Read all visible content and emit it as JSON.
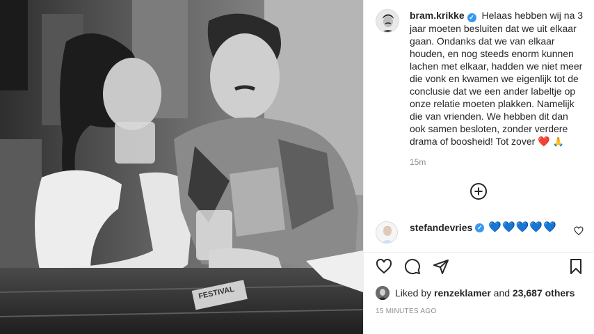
{
  "post": {
    "author": "bram.krikke",
    "caption": "Helaas hebben wij na 3 jaar moeten besluiten dat we uit elkaar gaan. Ondanks dat we van elkaar houden, en nog steeds enorm kunnen lachen met elkaar, hadden we niet meer die vonk en kwamen we eigenlijk tot de conclusie dat we een ander labeltje op onze relatie moeten plakken. Namelijk die van vrienden. We hebben dit dan ook samen besloten, zonder verdere drama of boosheid! Tot zover",
    "caption_emoji_heart": "❤️",
    "caption_emoji_pray": "🙏",
    "time": "15m",
    "photo_sign_text": "FESTIVAL",
    "photo_subject": "black-and-white photo of a couple at a wooden table with drinks"
  },
  "comment": {
    "user": "stefandevries",
    "text": "💙💙💙💙💙"
  },
  "actions": {
    "like": "heart-icon",
    "comment": "comment-icon",
    "share": "share-icon",
    "save": "bookmark-icon"
  },
  "likes": {
    "prefix": "Liked by",
    "liker": "renzeklamer",
    "connector": "and",
    "others": "23,687 others"
  },
  "timestamp": "15 MINUTES AGO",
  "colors": {
    "verified": "#3897f0",
    "heart_red": "#e0245e",
    "heart_blue": "#1d8ee8",
    "muted": "#8e8e8e",
    "text": "#262626"
  }
}
